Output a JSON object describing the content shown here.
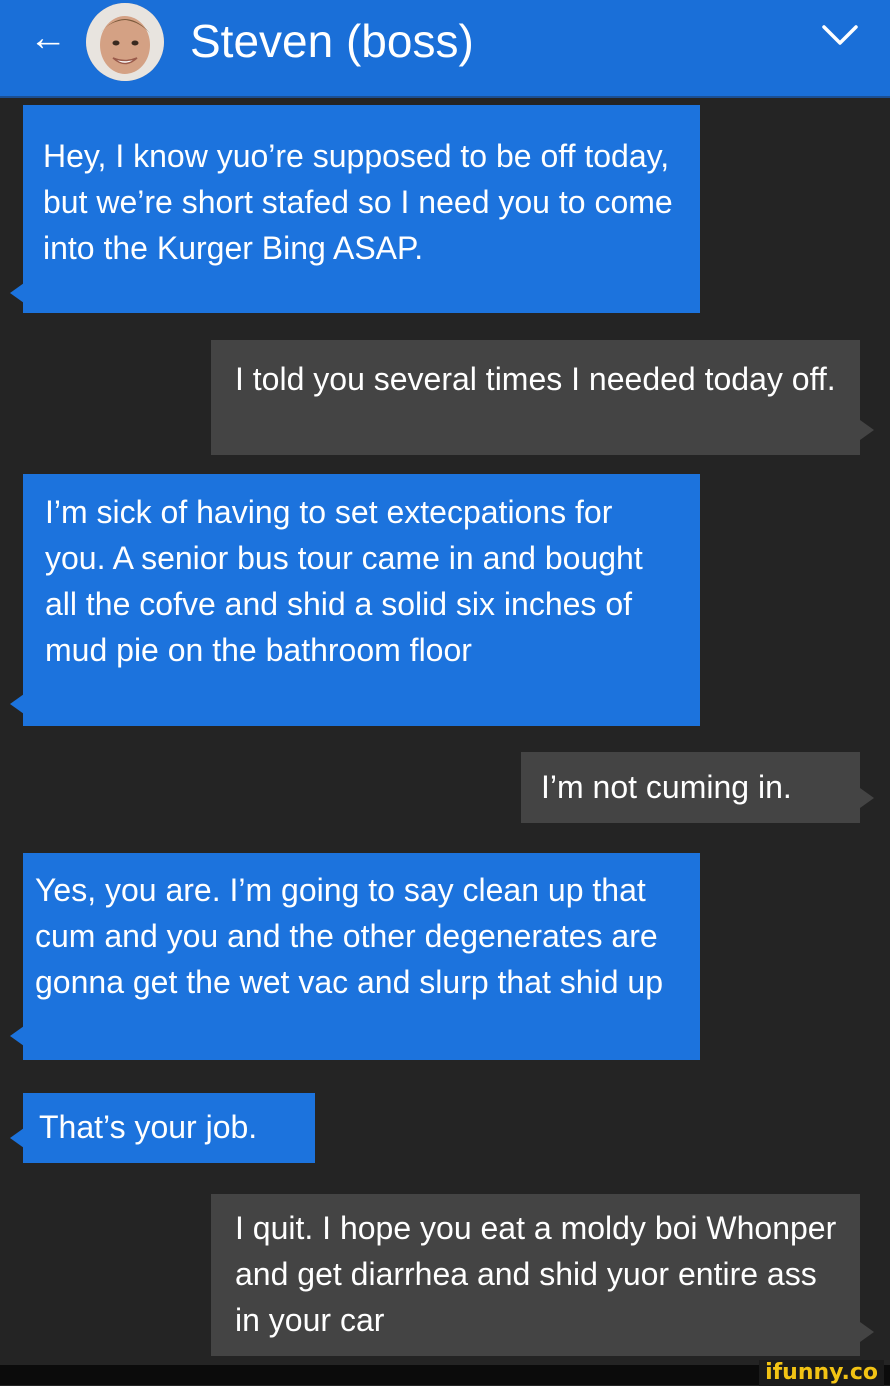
{
  "header": {
    "back_icon": "arrow-left-icon",
    "contact_name": "Steven (boss)",
    "menu_icon": "chevron-down-icon",
    "bar_color": "#1a6fd8"
  },
  "conversation": {
    "colors": {
      "incoming": "#1c73dd",
      "outgoing": "#444444",
      "background": "#242424"
    },
    "messages": [
      {
        "direction": "incoming",
        "text": "Hey, I know yuo’re supposed to be off today, but we’re short stafed so I need you to come into the Kurger Bing ASAP."
      },
      {
        "direction": "outgoing",
        "text": "I told you several times I needed today off."
      },
      {
        "direction": "incoming",
        "text": "I’m sick of having to set extecpations for you. A senior bus tour came in and bought all the cofve and shid a solid six inches of mud pie on the bathroom floor"
      },
      {
        "direction": "outgoing",
        "text": "I’m not cuming in."
      },
      {
        "direction": "incoming",
        "text": "Yes, you are. I’m going to say clean up that cum and you and the other degenerates are gonna get the wet vac and slurp that shid up"
      },
      {
        "direction": "incoming",
        "text": "That’s your job."
      },
      {
        "direction": "outgoing",
        "text": "I quit. I hope you eat a moldy boi Whonper and get diarrhea and shid yuor entire ass in your car"
      }
    ]
  },
  "watermark": "ifunny.co"
}
